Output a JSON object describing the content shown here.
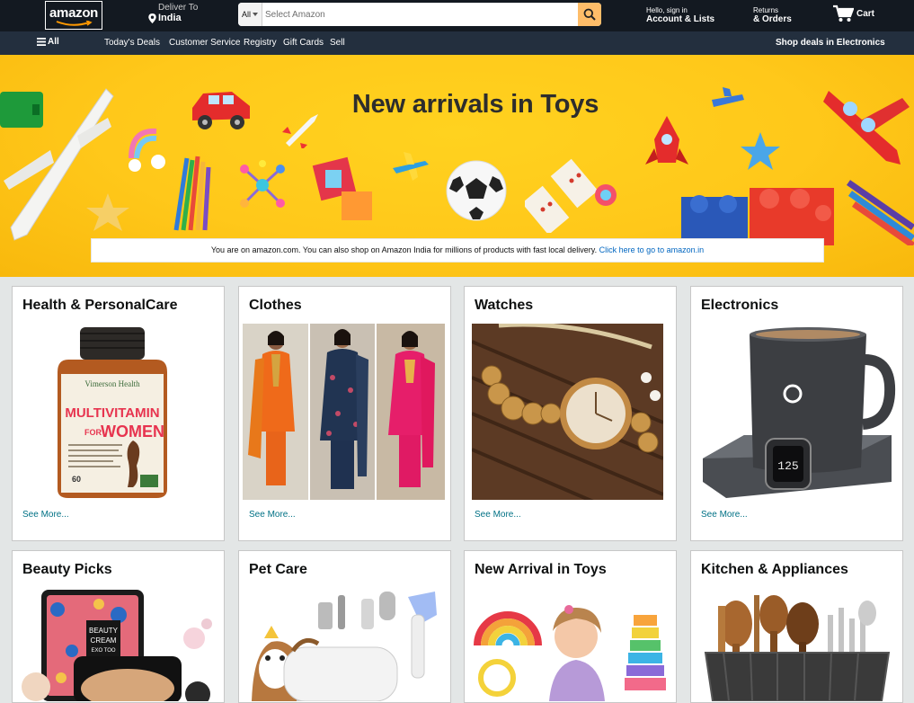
{
  "header": {
    "logo_text": "amazon",
    "deliver_label": "Deliver To",
    "deliver_location": "India",
    "search": {
      "category": "All",
      "placeholder": "Select Amazon"
    },
    "account": {
      "line1": "Hello, sign in",
      "line2": "Account & Lists"
    },
    "orders": {
      "line1": "Returns",
      "line2": "& Orders"
    },
    "cart_label": "Cart"
  },
  "subnav": {
    "all_label": "All",
    "items": [
      "Today's Deals",
      "Customer Service",
      "Registry",
      "Gift Cards",
      "Sell"
    ],
    "promo": "Shop deals in Electronics"
  },
  "hero": {
    "title": "New arrivals in Toys",
    "notice_text": "You are on amazon.com. You can also shop on Amazon India for millions of products with fast local delivery.",
    "notice_link": "Click here to go to amazon.in"
  },
  "cards": [
    {
      "title": "Health & PersonalCare",
      "more": "See More...",
      "product_text": {
        "brand": "Vimerson Health",
        "line1": "MULTIVITAMIN",
        "line2": "FOR",
        "line3": "WOMEN",
        "count": "60"
      }
    },
    {
      "title": "Clothes",
      "more": "See More..."
    },
    {
      "title": "Watches",
      "more": "See More..."
    },
    {
      "title": "Electronics",
      "more": "See More...",
      "product_text": {
        "display": "125"
      }
    },
    {
      "title": "Beauty Picks",
      "product_text": {
        "line1": "BEAUTY",
        "line2": "CREAM",
        "line3": "EXO TOO"
      }
    },
    {
      "title": "Pet Care"
    },
    {
      "title": "New Arrival in Toys"
    },
    {
      "title": "Kitchen & Appliances"
    }
  ],
  "colors": {
    "nav_dark": "#131921",
    "subnav": "#232f3e",
    "search_button": "#febd69",
    "link": "#007185",
    "hero_yellow": "#ffc81a"
  }
}
